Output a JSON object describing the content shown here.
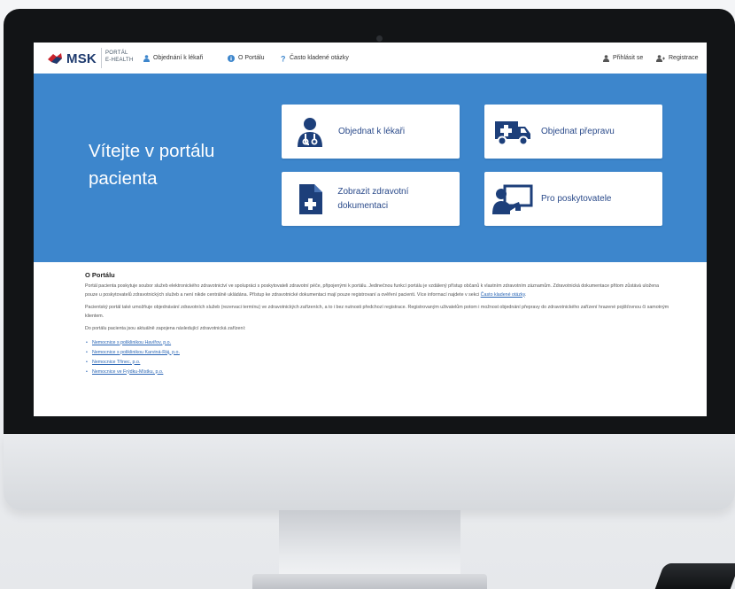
{
  "header": {
    "logo_text": "MSK",
    "portal_label": "PORTÁL",
    "portal_sublabel": "E-HEALTH",
    "nav": [
      {
        "label": "Objednání k lékaři",
        "icon": "user-icon"
      },
      {
        "label": "O Portálu",
        "icon": "info-icon"
      },
      {
        "label": "Často kladené otázky",
        "icon": "question-icon"
      }
    ],
    "login_label": "Přihlásit se",
    "register_label": "Registrace"
  },
  "hero": {
    "title": "Vítejte v portálu pacienta",
    "tiles": [
      {
        "label": "Objednat k lékaři",
        "icon": "doctor-icon"
      },
      {
        "label": "Objednat přepravu",
        "icon": "ambulance-icon"
      },
      {
        "label": "Zobrazit zdravotní dokumentaci",
        "icon": "medical-document-icon"
      },
      {
        "label": "Pro poskytovatele",
        "icon": "presenter-icon"
      }
    ]
  },
  "about": {
    "title": "O Portálu",
    "p1": "Portál pacienta poskytuje soubor služeb elektronického zdravotnictví ve spolupráci s poskytovateli zdravotní péče, připojenými k portálu. Jedinečnou funkcí portálu je vzdálený přístup občanů k vlastním zdravotním záznamům. Zdravotnická dokumentace přitom zůstává uložena pouze u poskytovatelů zdravotnických služeb a není nikde centrálně ukládána. Přístup ke zdravotnické dokumentaci mají pouze registrovaní a ověření pacienti. Více informací najdete v sekci",
    "p1_link": "Často kladené otázky",
    "p2": "Pacientský portál také umožňuje objednávání zdravotních služeb (rezervaci termínu) ve zdravotnických zařízeních, a to i bez nutnosti předchozí registrace. Registrovaným uživatelům potom i možnost objednání přepravy do zdravotnického zařízení hrazené pojišťovnou či samotným klientem.",
    "p3": "Do portálu pacienta jsou aktuálně zapojena následující zdravotnická zařízení:",
    "facilities": [
      "Nemocnice s poliklinikou Havířov, p.o.",
      "Nemocnice s poliklinikou Karviná-Ráj, p.o.",
      "Nemocnice Třinec, p.o.",
      "Nemocnice ve Frýdku-Místku, p.o."
    ]
  },
  "colors": {
    "hero_blue": "#3d86cc",
    "brand_navy": "#1e3a6e",
    "icon_navy": "#1d3f7a",
    "link_blue": "#2a66b5"
  }
}
